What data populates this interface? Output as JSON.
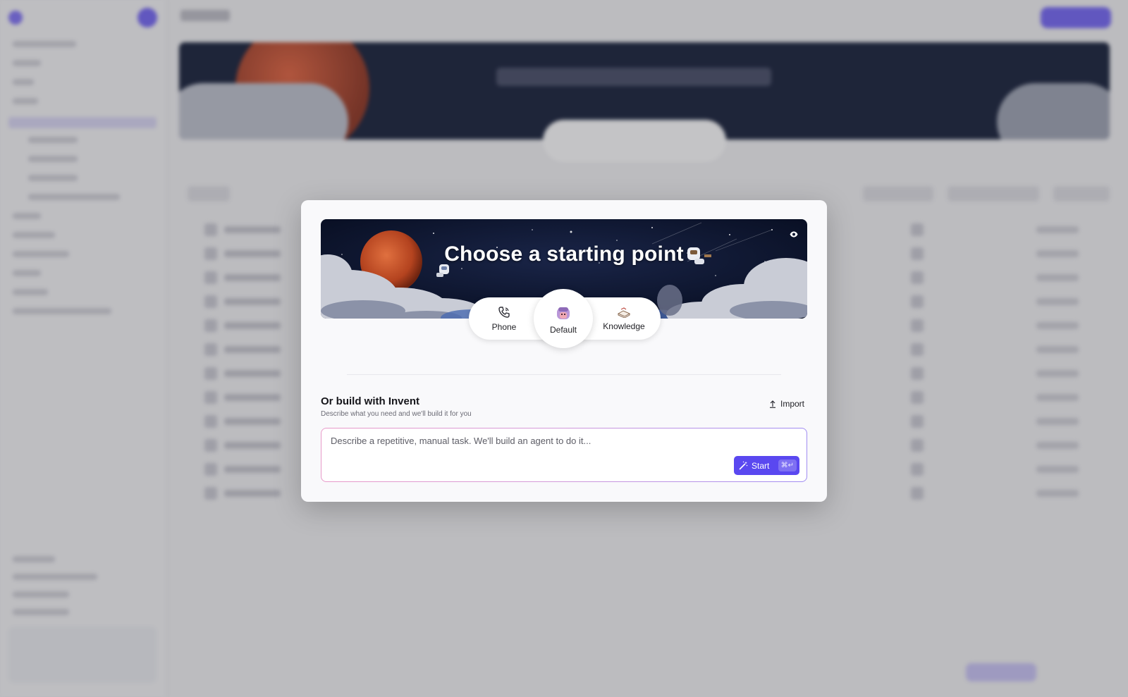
{
  "modal": {
    "banner_title": "Choose a starting point",
    "tabs": [
      {
        "label": "Phone",
        "icon": "phone-icon"
      },
      {
        "label": "Default",
        "icon": "default-avatar-icon",
        "selected": true
      },
      {
        "label": "Knowledge",
        "icon": "book-icon"
      }
    ],
    "build": {
      "title": "Or build with Invent",
      "subtitle": "Describe what you need and we'll build it for you",
      "import_label": "Import",
      "prompt_placeholder": "Describe a repetitive, manual task. We'll build an agent to do it...",
      "start_label": "Start",
      "shortcut": "⌘↵"
    }
  },
  "colors": {
    "accent": "#5a48f0",
    "banner_sky": "#0b1530",
    "planet": "#c9542c",
    "prompt_border_start": "#e89ac9",
    "prompt_border_end": "#a08cf2"
  }
}
